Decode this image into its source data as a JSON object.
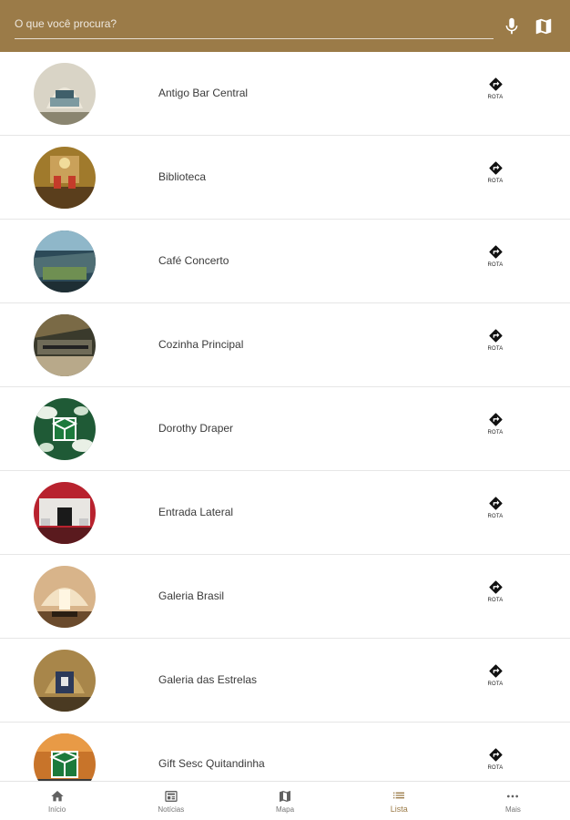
{
  "theme": {
    "header_bg": "#9b7b48",
    "accent": "#9b7b48"
  },
  "search": {
    "placeholder": "O que você procura?",
    "value": ""
  },
  "header_icons": [
    "microphone-icon",
    "map-icon"
  ],
  "list": {
    "route_label": "ROTA",
    "items": [
      {
        "label": "Antigo Bar Central"
      },
      {
        "label": "Biblioteca"
      },
      {
        "label": "Café Concerto"
      },
      {
        "label": "Cozinha Principal"
      },
      {
        "label": "Dorothy Draper"
      },
      {
        "label": "Entrada Lateral"
      },
      {
        "label": "Galeria Brasil"
      },
      {
        "label": "Galeria das Estrelas"
      },
      {
        "label": "Gift Sesc Quitandinha"
      }
    ]
  },
  "nav": {
    "items": [
      {
        "label": "Início",
        "icon": "home-icon"
      },
      {
        "label": "Notícias",
        "icon": "news-icon"
      },
      {
        "label": "Mapa",
        "icon": "map-icon"
      },
      {
        "label": "Lista",
        "icon": "list-icon",
        "active": true
      },
      {
        "label": "Mais",
        "icon": "more-icon"
      }
    ]
  }
}
